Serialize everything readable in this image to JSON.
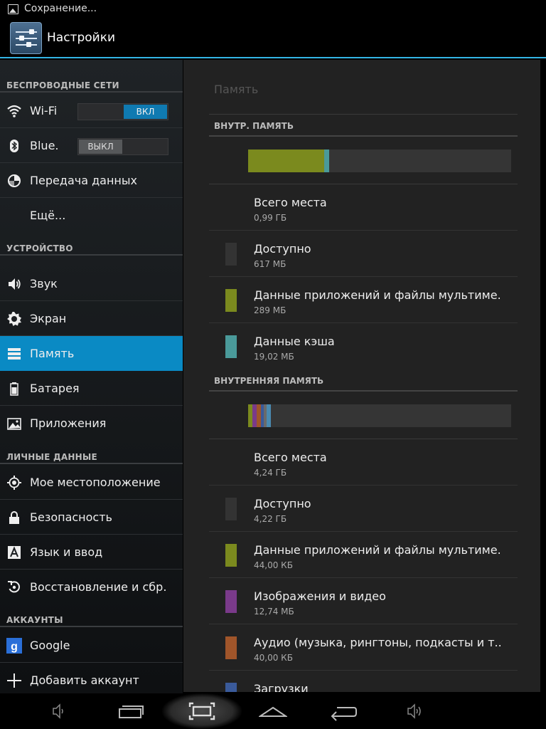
{
  "status_bar": {
    "message": "Сохранение..."
  },
  "action_bar": {
    "title": "Настройки"
  },
  "sidebar": {
    "sections": {
      "wireless": "БЕСПРОВОДНЫЕ СЕТИ",
      "device": "УСТРОЙСТВО",
      "personal": "ЛИЧНЫЕ ДАННЫЕ",
      "accounts": "АККАУНТЫ"
    },
    "items": {
      "wifi": {
        "label": "Wi-Fi",
        "toggle": "ВКЛ",
        "icon": "wifi-icon"
      },
      "bluetooth": {
        "label": "Blue.",
        "toggle": "ВЫКЛ",
        "icon": "bluetooth-icon"
      },
      "data": {
        "label": "Передача данных",
        "icon": "data-usage-icon"
      },
      "more": {
        "label": "Ещё..."
      },
      "sound": {
        "label": "Звук",
        "icon": "speaker-icon"
      },
      "display": {
        "label": "Экран",
        "icon": "brightness-icon"
      },
      "storage": {
        "label": "Память",
        "icon": "storage-icon"
      },
      "battery": {
        "label": "Батарея",
        "icon": "battery-icon"
      },
      "apps": {
        "label": "Приложения",
        "icon": "apps-icon"
      },
      "location": {
        "label": "Мое местоположение",
        "icon": "location-icon"
      },
      "security": {
        "label": "Безопасность",
        "icon": "lock-icon"
      },
      "language": {
        "label": "Язык и ввод",
        "icon": "language-icon"
      },
      "backup": {
        "label": "Восстановление и сбр.",
        "icon": "backup-icon"
      },
      "google": {
        "label": "Google",
        "icon": "google-icon"
      },
      "add_account": {
        "label": "Добавить аккаунт",
        "icon": "plus-icon"
      }
    }
  },
  "panel": {
    "title": "Память",
    "internal": {
      "heading": "ВНУТР. ПАМЯТЬ",
      "usage_fractions": {
        "apps": 0.29,
        "cache": 0.019
      },
      "rows": [
        {
          "title": "Всего места",
          "value": "0,99 ГБ"
        },
        {
          "title": "Доступно",
          "value": "617 МБ",
          "color": "#333333"
        },
        {
          "title": "Данные приложений и файлы мультиме.",
          "value": "289 МБ",
          "color": "#7b8a1e"
        },
        {
          "title": "Данные кэша",
          "value": "19,02 МБ",
          "color": "#4a9a9a"
        }
      ]
    },
    "sd": {
      "heading": "ВНУТРЕННЯЯ ПАМЯТЬ",
      "usage_fractions": {
        "apps": 0.015,
        "images": 0.015,
        "audio": 0.015,
        "downloads": 0.01,
        "misc": 0.01,
        "other": 0.015
      },
      "rows": [
        {
          "title": "Всего места",
          "value": "4,24 ГБ"
        },
        {
          "title": "Доступно",
          "value": "4,22 ГБ",
          "color": "#333333"
        },
        {
          "title": "Данные приложений и файлы мультиме.",
          "value": "44,00 КБ",
          "color": "#7b8a1e"
        },
        {
          "title": "Изображения и видео",
          "value": "12,74 МБ",
          "color": "#7a3a8a"
        },
        {
          "title": "Аудио (музыка, рингтоны, подкасты и т..",
          "value": "40,00 КБ",
          "color": "#a0552a"
        },
        {
          "title": "Загрузки",
          "value": "",
          "color": "#3a5a9a"
        }
      ]
    }
  },
  "nav_bar": {
    "buttons": [
      "volume-down-icon",
      "recent-apps-icon",
      "screenshot-icon",
      "home-icon",
      "back-icon",
      "volume-up-icon"
    ]
  }
}
